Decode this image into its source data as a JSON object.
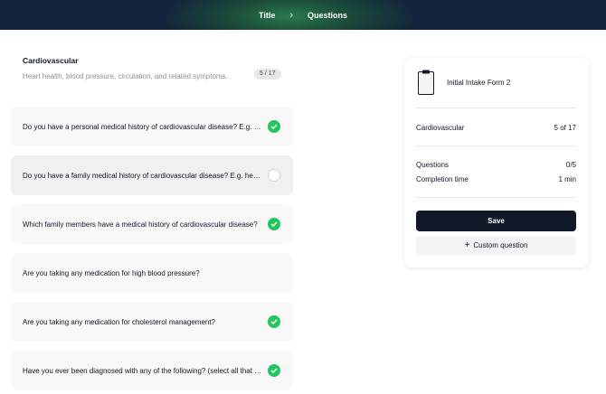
{
  "header": {
    "breadcrumb": [
      "Title",
      "Questions"
    ],
    "separator": "›"
  },
  "section": {
    "title": "Cardiovascular",
    "description": "Heart health, blood pressure, circulation, and related symptoms.",
    "count": "5 / 17"
  },
  "questions": [
    {
      "text": "Do you have a personal medical history of cardiovascular disease? E.g. heart attack, stroke",
      "checked": true
    },
    {
      "text": "Do you have a family medical history of cardiovascular disease? E.g. heart attack, stroke",
      "checked": false
    },
    {
      "text": "Which family members have a medical history of cardiovascular disease?",
      "checked": true
    },
    {
      "text": "Are you taking any medication for high blood pressure?",
      "checked": false
    },
    {
      "text": "Are you taking any medication for cholesterol management?",
      "checked": true
    },
    {
      "text": "Have you ever been diagnosed with any of the following? (select all that apply)",
      "checked": true
    }
  ],
  "summary": {
    "form_name": "Initial Intake Form 2",
    "category_label": "Cardiovascular",
    "category_value": "5 of 17",
    "questions_label": "Questions",
    "questions_value": "0/5",
    "time_label": "Completion time",
    "time_value": "1 min",
    "save_label": "Save",
    "custom_label": "Custom question",
    "custom_icon": "plus-icon"
  },
  "colors": {
    "check_on": "#22c55e",
    "button_dark": "#111827"
  }
}
